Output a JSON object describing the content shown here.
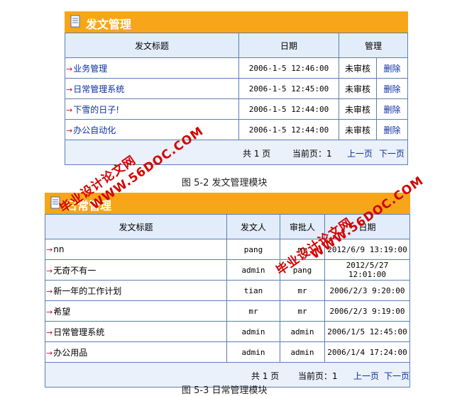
{
  "panel1": {
    "title": "发文管理",
    "columns": [
      "发文标题",
      "日期",
      "管理"
    ],
    "rows": [
      {
        "title": "业务管理",
        "date": "2006-1-5 12:46:00",
        "status": "未审核",
        "action": "删除"
      },
      {
        "title": "日常管理系统",
        "date": "2006-1-5 12:45:00",
        "status": "未审核",
        "action": "删除"
      },
      {
        "title": "下雪的日子!",
        "date": "2006-1-5 12:44:00",
        "status": "未审核",
        "action": "删除"
      },
      {
        "title": "办公自动化",
        "date": "2006-1-5 12:44:00",
        "status": "未审核",
        "action": "删除"
      }
    ],
    "footer": {
      "total": "共 1 页",
      "current": "当前页：1",
      "prev": "上一页",
      "next": "下一页"
    },
    "caption": "图 5-2 发文管理模块"
  },
  "panel2": {
    "title": "日常管理",
    "columns": [
      "发文标题",
      "发文人",
      "审批人",
      "日期"
    ],
    "rows": [
      {
        "title": "nn",
        "sender": "pang",
        "approver": "mr",
        "date": "2012/6/9 13:19:00"
      },
      {
        "title": "无奇不有一",
        "sender": "admin",
        "approver": "pang",
        "date": "2012/5/27 12:01:00"
      },
      {
        "title": "新一年的工作计划",
        "sender": "tian",
        "approver": "mr",
        "date": "2006/2/3 9:20:00"
      },
      {
        "title": "希望",
        "sender": "mr",
        "approver": "mr",
        "date": "2006/2/3 9:19:00"
      },
      {
        "title": "日常管理系统",
        "sender": "admin",
        "approver": "admin",
        "date": "2006/1/5 12:45:00"
      },
      {
        "title": "办公用品",
        "sender": "admin",
        "approver": "admin",
        "date": "2006/1/4 17:24:00"
      }
    ],
    "footer": {
      "total": "共 1 页",
      "current": "当前页：1",
      "prev": "上一页",
      "next": "下一页"
    },
    "caption": "图 5-3 日常管理模块"
  },
  "watermarks": {
    "site": "WWW.56DOC.COM",
    "cn": "毕业设计论文网"
  },
  "colors": {
    "header": "#f7a619",
    "border": "#5a7fb3",
    "link": "#0b2e9f",
    "arrow": "#c8102e",
    "watermark": "#d40000"
  }
}
